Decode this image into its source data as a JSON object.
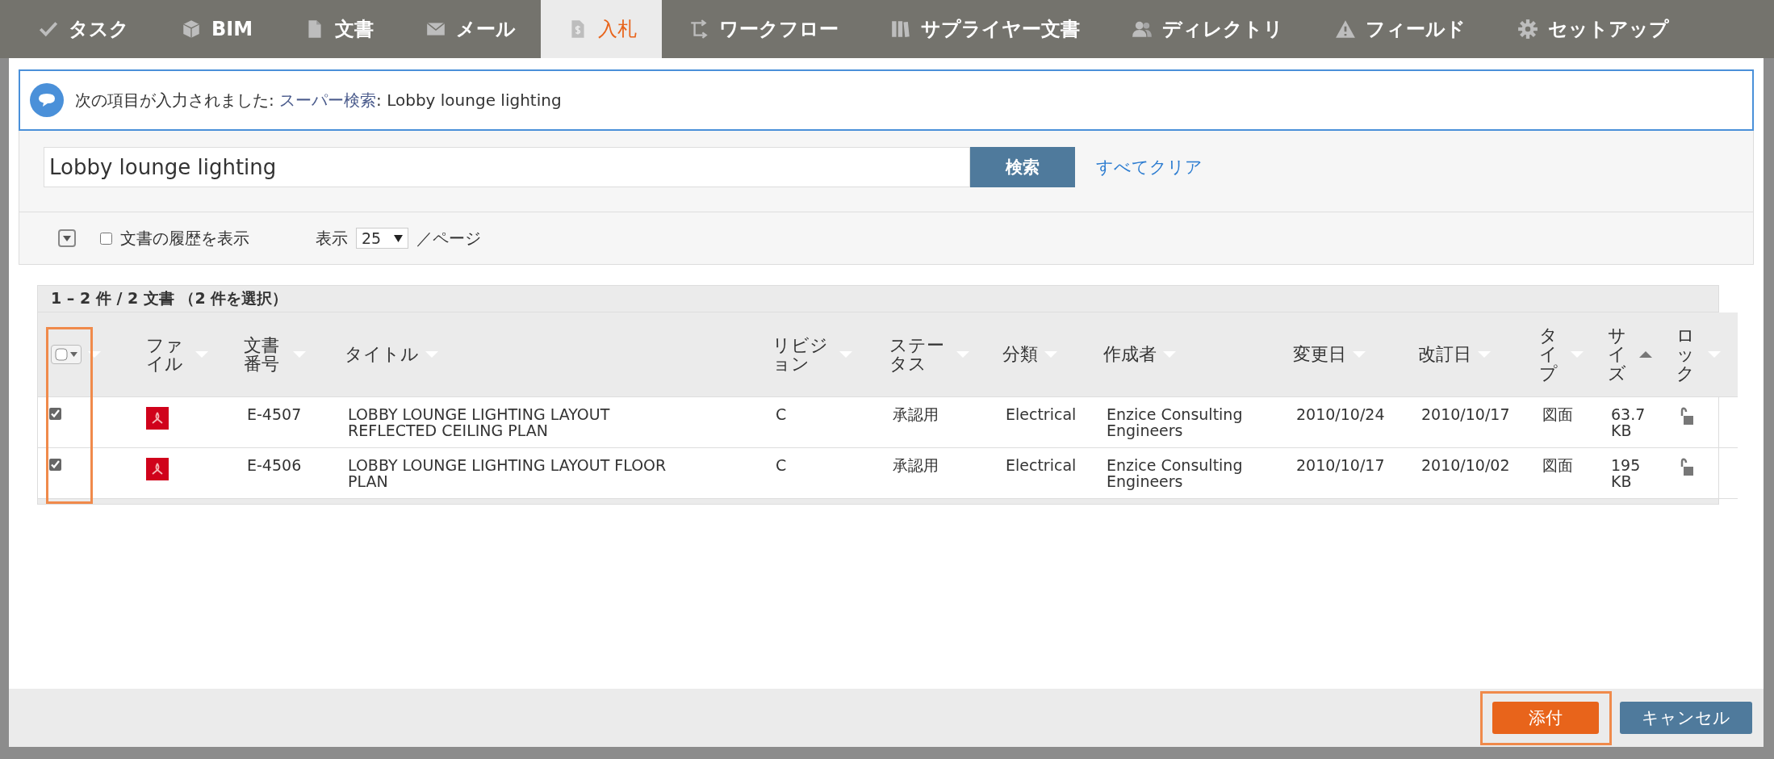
{
  "nav": {
    "tabs": [
      {
        "label": "タスク",
        "selected": false
      },
      {
        "label": "BIM",
        "selected": false
      },
      {
        "label": "文書",
        "selected": false
      },
      {
        "label": "メール",
        "selected": false
      },
      {
        "label": "入札",
        "selected": true
      },
      {
        "label": "ワークフロー",
        "selected": false
      },
      {
        "label": "サプライヤー文書",
        "selected": false
      },
      {
        "label": "ディレクトリ",
        "selected": false
      },
      {
        "label": "フィールド",
        "selected": false
      },
      {
        "label": "セットアップ",
        "selected": false
      }
    ]
  },
  "message": {
    "prefix": "次の項目が入力されました: ",
    "link": "スーパー検索",
    "suffix": ": Lobby lounge lighting"
  },
  "search": {
    "value": "Lobby lounge lighting",
    "button": "検索",
    "clear_link": "すべてクリア"
  },
  "options": {
    "history_checkbox": {
      "label": "文書の履歴を表示",
      "checked": false
    },
    "page_size": {
      "label": "表示",
      "value": "25",
      "suffix": "／ページ"
    }
  },
  "table": {
    "summary": "1 – 2 件 / 2 文書 （2 件を選択）",
    "select_all": {
      "checked": false,
      "highlighted": true
    },
    "columns": [
      {
        "label": "ファイル",
        "sorted": false
      },
      {
        "label": "文書番号",
        "sorted": false
      },
      {
        "label": "タイトル",
        "sorted": false
      },
      {
        "label": "リビジョン",
        "sorted": false
      },
      {
        "label": "ステータス",
        "sorted": false
      },
      {
        "label": "分類",
        "sorted": false
      },
      {
        "label": "作成者",
        "sorted": false
      },
      {
        "label": "変更日",
        "sorted": false
      },
      {
        "label": "改訂日",
        "sorted": false
      },
      {
        "label": "タイプ",
        "sorted": false
      },
      {
        "label": "サイズ",
        "sorted": true
      },
      {
        "label": "ロック",
        "sorted": false
      }
    ],
    "rows": [
      {
        "checked": true,
        "kind": "pdf",
        "number": "E-4507",
        "title": "LOBBY LOUNGE LIGHTING LAYOUT REFLECTED CEILING PLAN",
        "revision": "C",
        "status": "承認用",
        "category": "Electrical",
        "author": "Enzice Consulting Engineers",
        "modified": "2010/10/24",
        "revised": "2010/10/17",
        "type": "図面",
        "size": "63.7 KB",
        "locked": false
      },
      {
        "checked": true,
        "kind": "pdf",
        "number": "E-4506",
        "title": "LOBBY LOUNGE LIGHTING LAYOUT FLOOR PLAN",
        "revision": "C",
        "status": "承認用",
        "category": "Electrical",
        "author": "Enzice Consulting Engineers",
        "modified": "2010/10/17",
        "revised": "2010/10/02",
        "type": "図面",
        "size": "195 KB",
        "locked": false
      }
    ]
  },
  "footer": {
    "buttons": [
      {
        "label": "添付",
        "kind": "primary",
        "highlighted": true
      },
      {
        "label": "キャンセル",
        "kind": "secondary",
        "highlighted": false
      }
    ]
  }
}
